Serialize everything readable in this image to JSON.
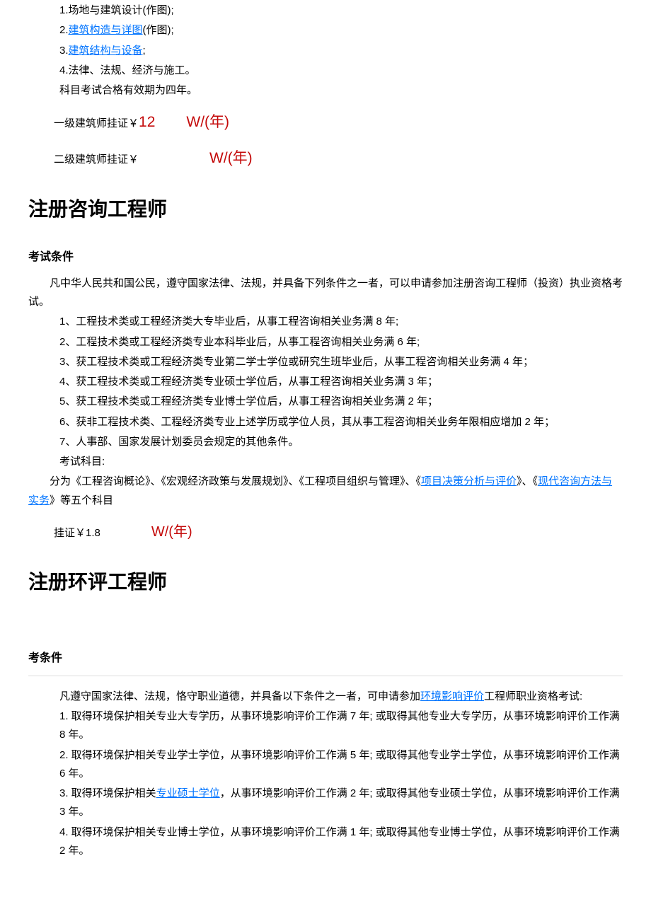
{
  "architect": {
    "subjects": {
      "s1_prefix": "1.",
      "s1": "场地与建筑设计(作图);",
      "s2_prefix": "2.",
      "s2_link": "建筑构造与详图",
      "s2_suffix": "(作图);",
      "s3_prefix": "3.",
      "s3_link": "建筑结构与设备",
      "s3_suffix": ";",
      "s4": "4.法律、法规、经济与施工。",
      "validity": "科目考试合格有效期为四年。"
    },
    "price1": {
      "label": "一级建筑师挂证￥",
      "num": "12",
      "unit": "W/(年)"
    },
    "price2": {
      "label": "二级建筑师挂证￥",
      "num": "",
      "unit": "W/(年)"
    }
  },
  "consult": {
    "title": "注册咨询工程师",
    "cond_heading": "考试条件",
    "intro": "凡中华人民共和国公民，遵守国家法律、法规，并具备下列条件之一者，可以申请参加注册咨询工程师（投资）执业资格考试。",
    "c1": "1、工程技术类或工程经济类大专毕业后，从事工程咨询相关业务满 8 年;",
    "c2": "2、工程技术类或工程经济类专业本科毕业后，从事工程咨询相关业务满 6 年;",
    "c3": "3、获工程技术类或工程经济类专业第二学士学位或研究生班毕业后，从事工程咨询相关业务满 4 年；",
    "c4": "4、获工程技术类或工程经济类专业硕士学位后，从事工程咨询相关业务满 3 年；",
    "c5": "5、获工程技术类或工程经济类专业博士学位后，从事工程咨询相关业务满 2 年；",
    "c6": "6、获非工程技术类、工程经济类专业上述学历或学位人员，其从事工程咨询相关业务年限相应增加 2 年；",
    "c7": "7、人事部、国家发展计划委员会规定的其他条件。",
    "subj_label": "考试科目:",
    "subj_a": "分为《工程咨询概论》、《宏观经济政策与发展规划》、《工程项目组织与管理》、《",
    "subj_link1": "项目决策分析与评价",
    "subj_b": "》、《",
    "subj_link2": "现代咨询方法与实务",
    "subj_c": "》等五个科目",
    "price": {
      "label": "挂证￥",
      "num": "1.8",
      "unit": "W/(年)"
    }
  },
  "hp": {
    "title": "注册环评工程师",
    "cond_heading": "考条件",
    "intro_a": "凡遵守国家法律、法规，恪守职业道德，并具备以下条件之一者，可申请参加",
    "intro_link": "环境影响评价",
    "intro_b": "工程师职业资格考试:",
    "c1": "1. 取得环境保护相关专业大专学历，从事环境影响评价工作满 7 年; 或取得其他专业大专学历，从事环境影响评价工作满 8 年。",
    "c2": "2. 取得环境保护相关专业学士学位，从事环境影响评价工作满 5 年; 或取得其他专业学士学位，从事环境影响评价工作满 6 年。",
    "c3_a": "3. 取得环境保护相关",
    "c3_link": "专业硕士学位",
    "c3_b": "，从事环境影响评价工作满 2 年; 或取得其他专业硕士学位，从事环境影响评价工作满 3 年。",
    "c4": "4. 取得环境保护相关专业博士学位，从事环境影响评价工作满 1 年; 或取得其他专业博士学位，从事环境影响评价工作满 2 年。"
  }
}
